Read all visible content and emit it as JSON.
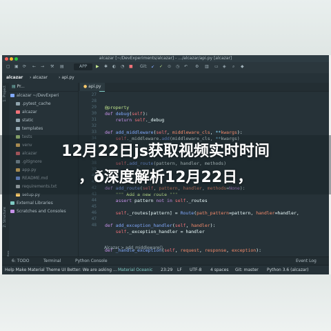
{
  "window": {
    "title": "alcazar [~/DevExperiments/alcazar] - .../alcazar/api.py [alcazar]"
  },
  "toolbar": {
    "run_config": "APP",
    "git_label": "Git:"
  },
  "navbar": {
    "project": "alcazar",
    "crumbs": [
      "alcazar",
      "api.py"
    ]
  },
  "sidebar": {
    "header": "Pr...",
    "items": [
      {
        "label": "alcazar ~/DevExperi",
        "icon": "folder-icon"
      },
      {
        "label": ".pytest_cache",
        "icon": "folder-icon"
      },
      {
        "label": "alcazar",
        "icon": "folder-icon"
      },
      {
        "label": "static",
        "icon": "folder-icon"
      },
      {
        "label": "templates",
        "icon": "folder-icon"
      },
      {
        "label": "tests",
        "icon": "folder-icon"
      },
      {
        "label": "venv",
        "icon": "folder-icon"
      },
      {
        "label": "alcazar",
        "icon": "folder-icon"
      },
      {
        "label": ".gitignore",
        "icon": "file-icon"
      },
      {
        "label": "app.py",
        "icon": "python-file-icon"
      },
      {
        "label": "README.md",
        "icon": "markdown-file-icon"
      },
      {
        "label": "requirements.txt",
        "icon": "text-file-icon"
      },
      {
        "label": "setup.py",
        "icon": "python-file-icon"
      },
      {
        "label": "External Libraries",
        "icon": "library-icon"
      },
      {
        "label": "Scratches and Consoles",
        "icon": "console-icon"
      }
    ],
    "side_tabs": [
      "1: Project",
      "2: Structure",
      "2: Favorites"
    ]
  },
  "editor": {
    "tabs": [
      "api.py"
    ],
    "line_numbers": [
      "27",
      "28",
      "29",
      "30",
      "31",
      "32",
      "33",
      "34",
      "35",
      "36",
      "37",
      "38",
      "39",
      "40",
      "41",
      "42",
      "43",
      "44",
      "45",
      "46",
      "47",
      "48"
    ],
    "breadcrumb": "Alcazar  >  add_middleware()"
  },
  "bottom_tabs": [
    "6: TODO",
    "Terminal",
    "Python Console",
    "Event Log"
  ],
  "statusbar": {
    "message": "Help Make Material Theme UI Better: We are asking ...",
    "theme": "Material Oceanic",
    "position": "23:29",
    "line_sep": "LF",
    "encoding": "UTF-8",
    "indent": "4 spaces",
    "git": "Git: master",
    "python": "Python 3.6 (alcazar)"
  },
  "headline": {
    "line1": "12月22日js获取视频实时时间",
    "line2": "，ð深度解析12月22日，"
  },
  "colors": {
    "ide_bg": "#263238",
    "accent": "#80cbc4",
    "keyword": "#c792ea",
    "function": "#82aaff",
    "self": "#f07178",
    "param": "#f78c6c"
  }
}
